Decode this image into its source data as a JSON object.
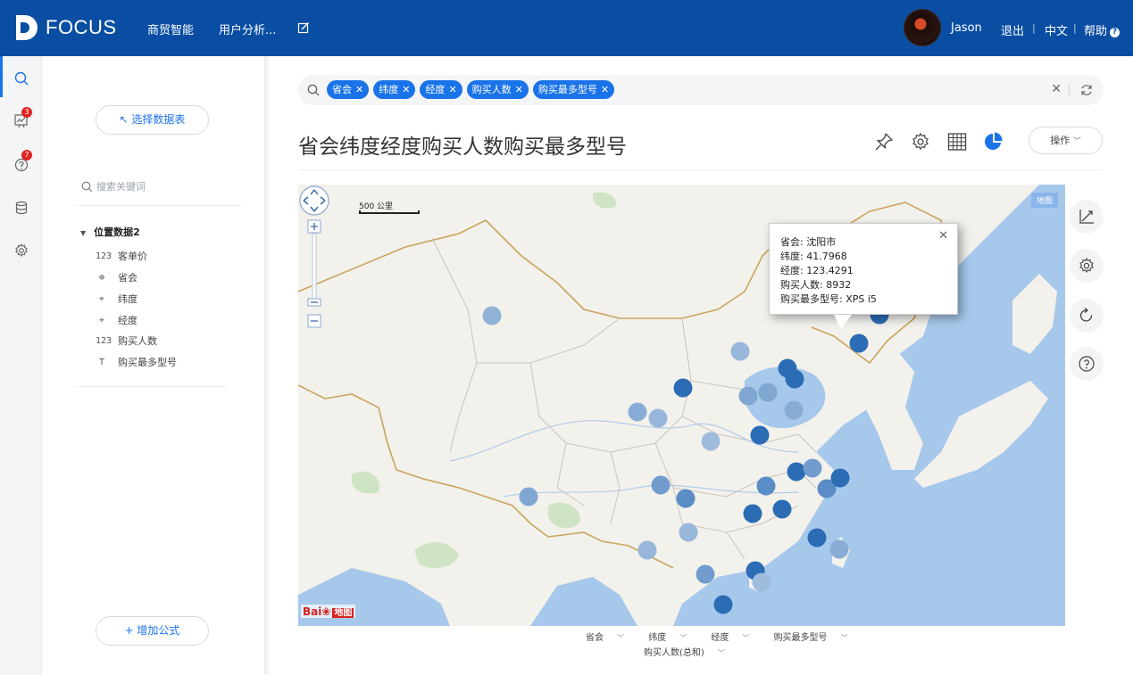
{
  "app": {
    "logo_text": "FOCUS",
    "nav": [
      "商贸智能",
      "用户分析..."
    ],
    "user_name": "Jason",
    "logout": "退出",
    "language": "中文",
    "help": "帮助"
  },
  "rail": {
    "badges": {
      "history": "3",
      "help": "7"
    }
  },
  "panel": {
    "select_table": "↖ 选择数据表",
    "search_placeholder": "搜索关键词",
    "dataset": "位置数据2",
    "fields": [
      {
        "label": "客单价",
        "icon": "123"
      },
      {
        "label": "省会",
        "icon": "globe"
      },
      {
        "label": "纬度",
        "icon": "map-pin"
      },
      {
        "label": "经度",
        "icon": "map-pin"
      },
      {
        "label": "购买人数",
        "icon": "123"
      },
      {
        "label": "购买最多型号",
        "icon": "T"
      }
    ],
    "add_formula": "+ 增加公式"
  },
  "search": {
    "tags": [
      "省会",
      "纬度",
      "经度",
      "购买人数",
      "购买最多型号"
    ]
  },
  "page": {
    "title": "省会纬度经度购买人数购买最多型号",
    "operate": "操作"
  },
  "map": {
    "type_label": "地图",
    "scale_label": "500 公里",
    "attribution": "Bai",
    "attribution_suffix": "地图",
    "tooltip": {
      "lines": [
        "省会: 沈阳市",
        "纬度: 41.7968",
        "经度: 123.4291",
        "购买人数: 8932",
        "购买最多型号: XPS i5"
      ]
    }
  },
  "axes": {
    "row1": [
      "省会",
      "纬度",
      "经度",
      "购买最多型号"
    ],
    "row2": [
      "购买人数(总和)"
    ]
  },
  "colors": {
    "brand": "#0a4ea3",
    "accent": "#1a73e8",
    "point_dark": "#2b6cb5",
    "point_light": "#c6d7ea"
  }
}
